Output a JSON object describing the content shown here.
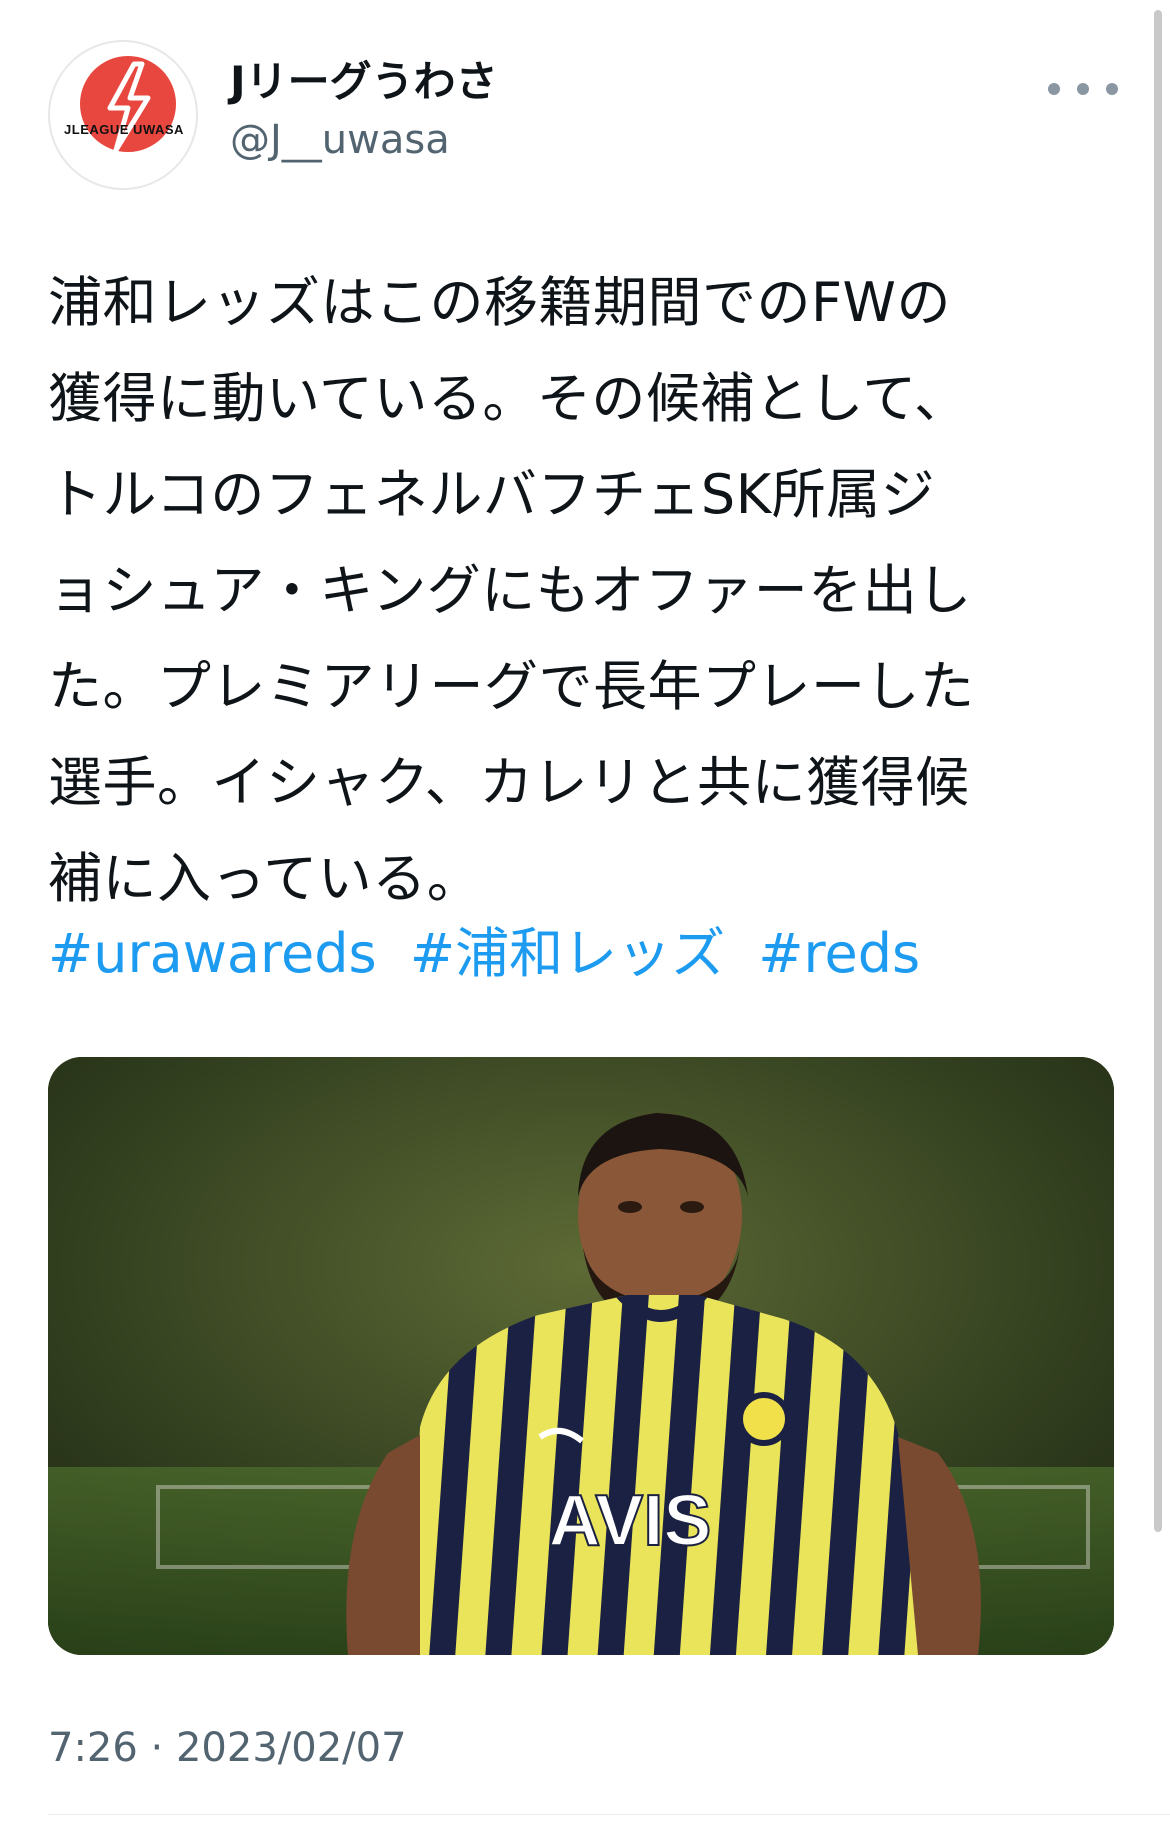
{
  "account": {
    "display_name": "Jリーグうわさ",
    "handle": "@J__uwasa",
    "avatar_text": "JLEAGUE UWASA",
    "avatar_icon": "lightning-bolt-icon",
    "more_icon": "more-horizontal-icon"
  },
  "tweet": {
    "lines": [
      "浦和レッズはこの移籍期間でのFWの",
      "獲得に動いている。その候補として、",
      "トルコのフェネルバフチェSK所属ジ",
      "ョシュア・キングにもオファーを出し",
      "た。プレミアリーグで長年プレーした",
      "選手。イシャク、カレリと共に獲得候",
      "補に入っている。"
    ],
    "hashtags": [
      "#urawareds",
      "#浦和レッズ",
      "#reds"
    ],
    "media_jersey_text": "AVIS",
    "timestamp": "7:26 · 2023/02/07"
  },
  "colors": {
    "accent": "#1d9bf0",
    "text": "#0f1419",
    "secondary": "#536471",
    "avatar_red": "#e8473f"
  }
}
